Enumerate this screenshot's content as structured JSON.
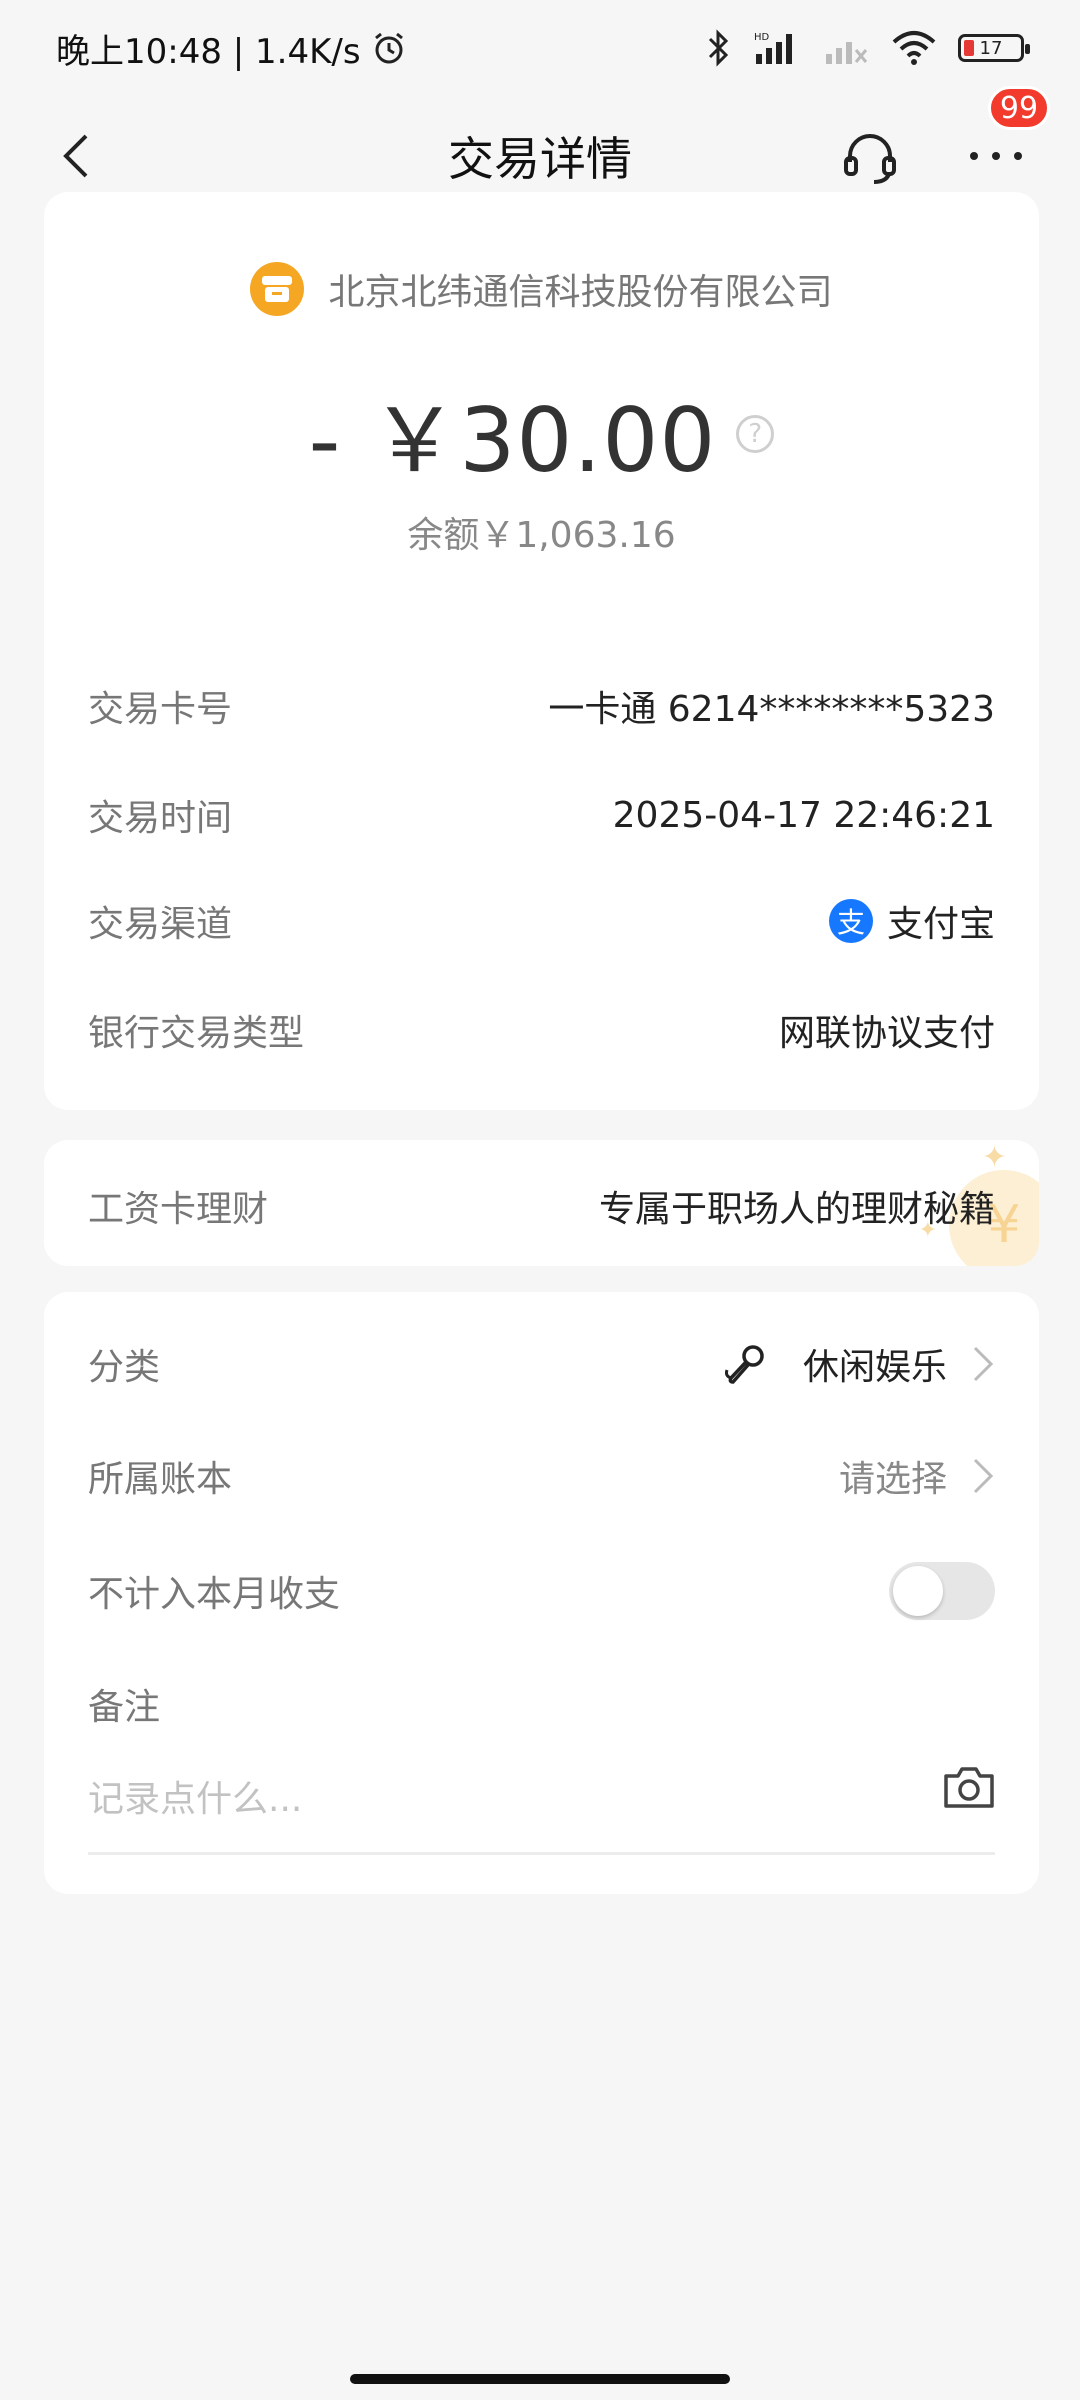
{
  "status_bar": {
    "time_speed": "晚上10:48 | 1.4K/s",
    "battery": "17"
  },
  "nav": {
    "title": "交易详情",
    "badge": "99"
  },
  "transaction": {
    "merchant": "北京北纬通信科技股份有限公司",
    "amount": "- ￥30.00",
    "balance": "余额￥1,063.16",
    "details": [
      {
        "label": "交易卡号",
        "value": "一卡通 6214********5323"
      },
      {
        "label": "交易时间",
        "value": "2025-04-17 22:46:21"
      },
      {
        "label": "交易渠道",
        "value": "支付宝"
      },
      {
        "label": "银行交易类型",
        "value": "网联协议支付"
      }
    ]
  },
  "promo": {
    "label": "工资卡理财",
    "value": "专属于职场人的理财秘籍",
    "deco_symbol": "¥"
  },
  "settings": {
    "category_label": "分类",
    "category_value": "休闲娱乐",
    "ledger_label": "所属账本",
    "ledger_value": "请选择",
    "exclude_label": "不计入本月收支",
    "exclude_on": false,
    "note_label": "备注",
    "note_placeholder": "记录点什么..."
  },
  "icons": {
    "alipay": "支",
    "help": "?"
  },
  "colors": {
    "merchant_logo": "#f5a623",
    "alipay_blue": "#1677ff",
    "badge_red": "#f23b2c"
  }
}
